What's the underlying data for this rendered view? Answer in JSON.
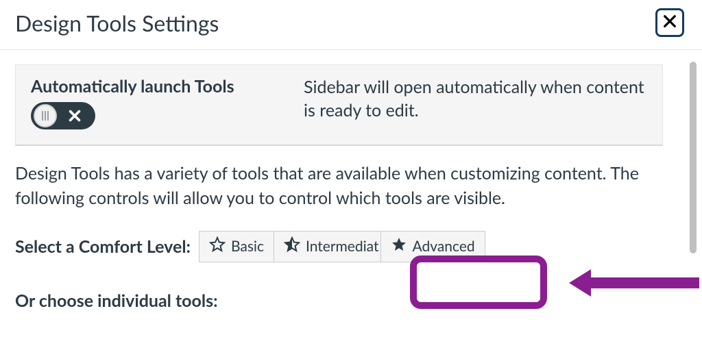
{
  "header": {
    "title": "Design Tools Settings"
  },
  "auto_launch": {
    "title": "Automatically launch Tools",
    "toggle_state": "off",
    "description": "Sidebar will open automatically when content is ready to edit."
  },
  "description": "Design Tools has a variety of tools that are available when customizing content. The following controls will allow you to control which tools are visible.",
  "comfort": {
    "label": "Select a Comfort Level:",
    "options": {
      "basic": "Basic",
      "intermediate": "Intermediat",
      "advanced": "Advanced"
    },
    "selected": "advanced"
  },
  "individual_label": "Or choose individual tools:",
  "annotation": {
    "highlight_color": "#8a1e91"
  }
}
